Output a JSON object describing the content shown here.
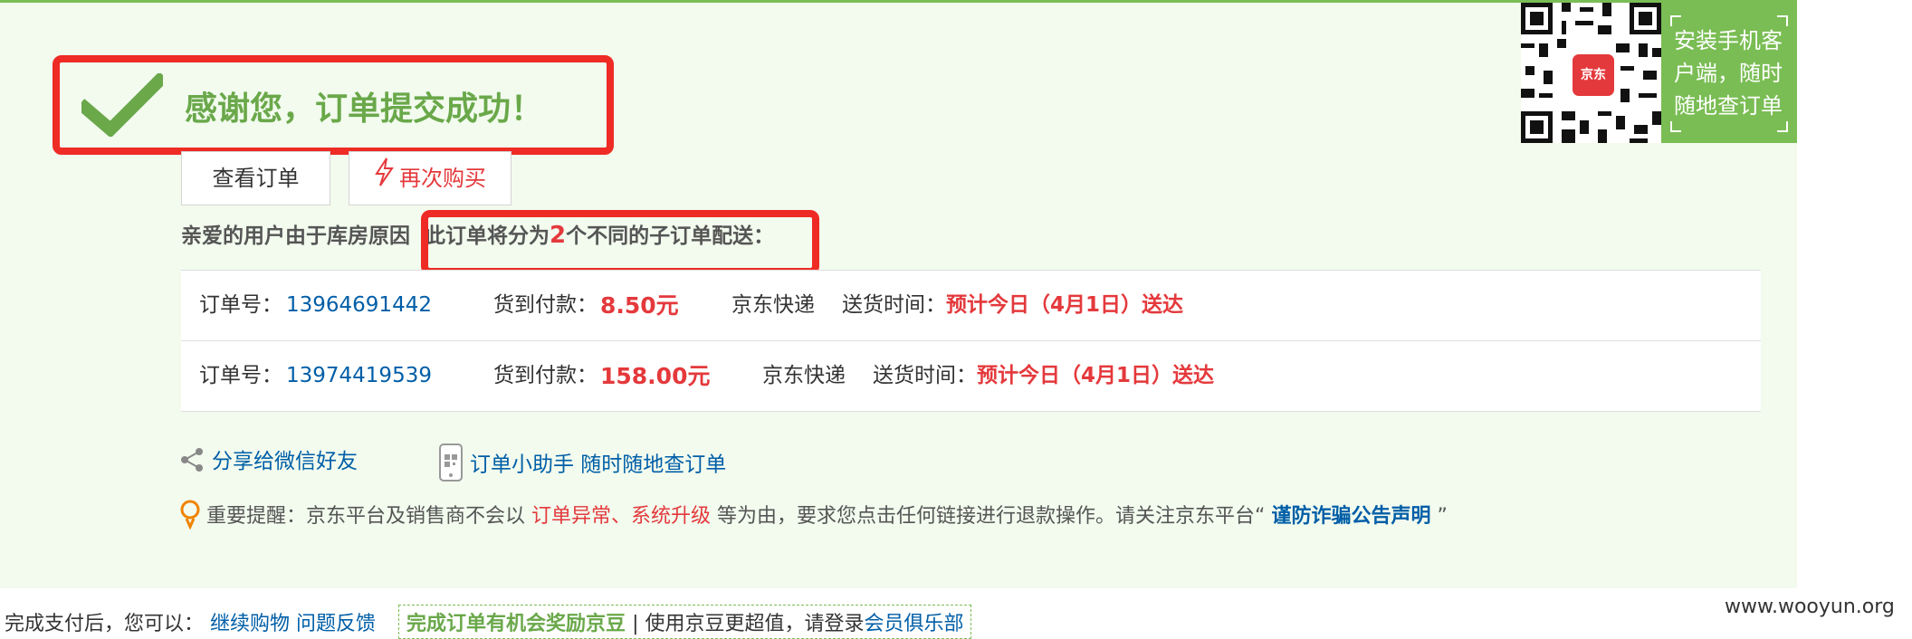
{
  "success": {
    "title": "感谢您，订单提交成功！"
  },
  "buttons": {
    "view_order": "查看订单",
    "buy_again": "再次购买"
  },
  "notice": {
    "prefix": "亲爱的用户由于库房原因",
    "split_pre": "此订单将分为",
    "split_count": "2",
    "split_post": "个不同的子订单配送："
  },
  "orders": [
    {
      "order_label": "订单号：",
      "order_no": "13964691442",
      "pay_label": "货到付款：",
      "amount": "8.50元",
      "carrier": "京东快递",
      "time_label": "送货时间：",
      "delivery": "预计今日（4月1日）送达"
    },
    {
      "order_label": "订单号：",
      "order_no": "13974419539",
      "pay_label": "货到付款：",
      "amount": "158.00元",
      "carrier": "京东快递",
      "time_label": "送货时间：",
      "delivery": "预计今日（4月1日）送达"
    }
  ],
  "share": {
    "wechat": "分享给微信好友",
    "helper": "订单小助手 随时随地查订单"
  },
  "reminder": {
    "pre": "重要提醒：京东平台及销售商不会以",
    "highlight": "订单异常、系统升级",
    "mid": "等为由，要求您点击任何链接进行退款操作。请关注京东平台“",
    "link": "谨防诈骗公告声明",
    "post": "”"
  },
  "qr": {
    "app_label": "京东",
    "install_text": "安装手机客户端，随时随地查订单"
  },
  "footer": {
    "after_pay": "完成支付后，您可以：",
    "continue_shopping": "继续购物",
    "feedback": "问题反馈",
    "bean_text": "完成订单有机会奖励京豆",
    "bean_rest": "| 使用京豆更超值，请登录",
    "club": "会员俱乐部"
  },
  "watermark": "www.wooyun.org",
  "colors": {
    "panel_bg": "#f2fbee",
    "accent_green": "#7abd54",
    "price_red": "#e4393c",
    "link_blue": "#005ea7",
    "annotation_red": "#ee2b24"
  }
}
